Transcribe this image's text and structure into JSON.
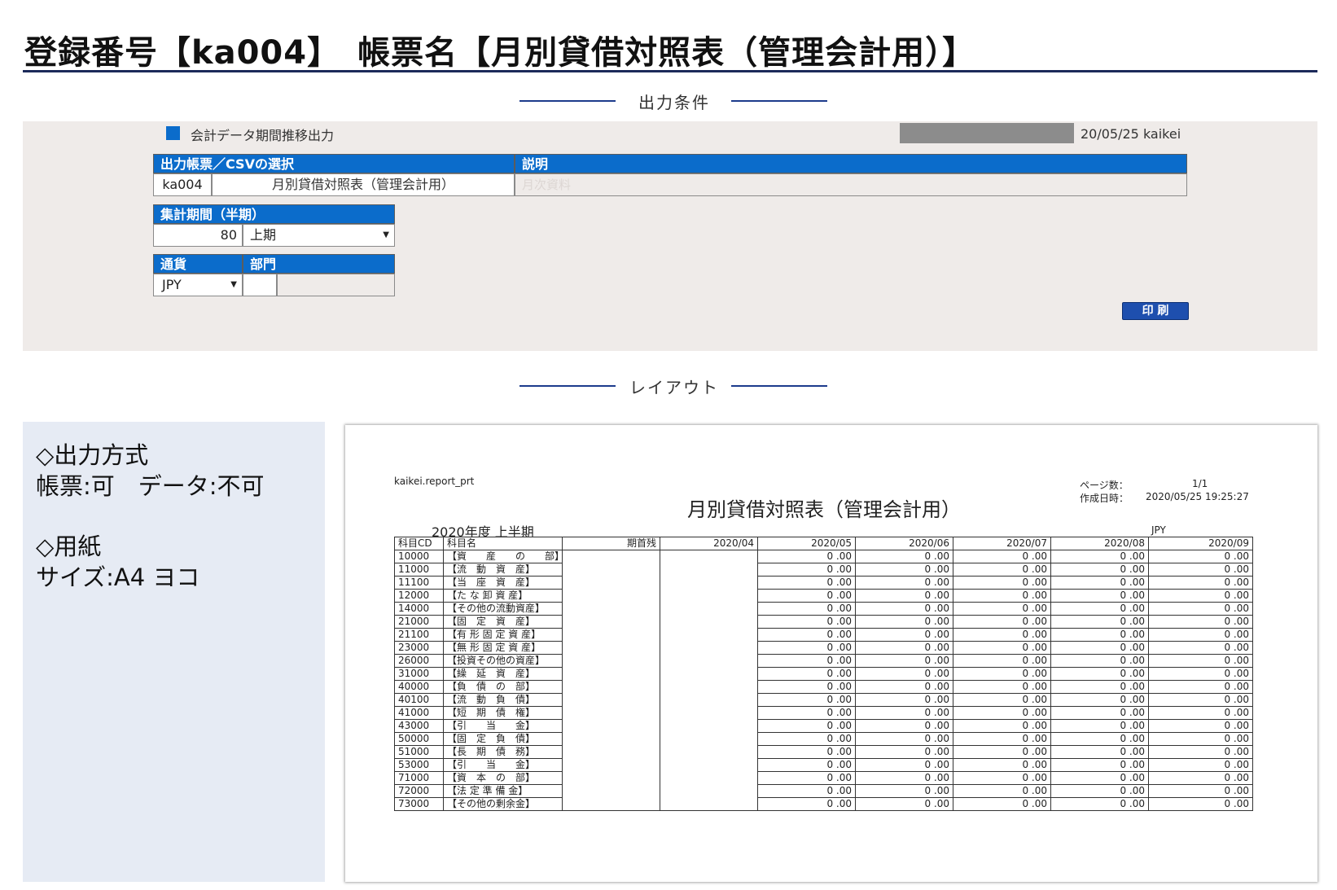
{
  "page_title": "登録番号【ka004】　帳票名【月別貸借対照表（管理会計用）】",
  "sections": {
    "conditions": "出力条件",
    "layout": "レイアウト"
  },
  "conditions": {
    "menu_label": "会計データ期間推移出力",
    "header_date_user": "20/05/25 kaikei",
    "colors": {
      "header_blue": "#0b6ccb",
      "button_blue": "#1e4fae",
      "panel_bg": "#efebe9"
    },
    "report_select": {
      "header_left": "出力帳票／CSVの選択",
      "header_right": "説明",
      "code": "ka004",
      "name": "月別貸借対照表（管理会計用）",
      "description": "月次資料"
    },
    "period": {
      "header": "集計期間（半期）",
      "value": "80",
      "selected": "上期"
    },
    "currency": {
      "header": "通貨",
      "selected": "JPY"
    },
    "department": {
      "header": "部門",
      "value": ""
    },
    "print_button": "印 刷"
  },
  "info": {
    "output_method_title": "◇出力方式",
    "output_method_value": "帳票:可　データ:不可",
    "paper_title": "◇用紙",
    "paper_value": "サイズ:A4 ヨコ"
  },
  "report": {
    "program": "kaikei.report_prt",
    "page_label": "ページ数：",
    "page_value": "1/1",
    "created_label": "作成日時：",
    "created_value": "2020/05/25 19:25:27",
    "title": "月別貸借対照表（管理会計用）",
    "period_label": "2020年度 上半期",
    "currency": "JPY",
    "columns": [
      "科目CD",
      "科目名",
      "期首残",
      "2020/04",
      "2020/05",
      "2020/06",
      "2020/07",
      "2020/08",
      "2020/09"
    ],
    "rows": [
      {
        "cd": "10000",
        "name": "【資　　産　　の　　部】",
        "values": [
          "",
          "",
          "0 .00",
          "0 .00",
          "0 .00",
          "0 .00",
          "0 .00"
        ]
      },
      {
        "cd": "11000",
        "name": "【流　動　資　産】",
        "values": [
          "",
          "",
          "0 .00",
          "0 .00",
          "0 .00",
          "0 .00",
          "0 .00"
        ]
      },
      {
        "cd": "11100",
        "name": "【当　座　資　産】",
        "values": [
          "",
          "",
          "0 .00",
          "0 .00",
          "0 .00",
          "0 .00",
          "0 .00"
        ]
      },
      {
        "cd": "12000",
        "name": "【た な 卸 資 産】",
        "values": [
          "",
          "",
          "0 .00",
          "0 .00",
          "0 .00",
          "0 .00",
          "0 .00"
        ]
      },
      {
        "cd": "14000",
        "name": "【その他の流動資産】",
        "values": [
          "",
          "",
          "0 .00",
          "0 .00",
          "0 .00",
          "0 .00",
          "0 .00"
        ]
      },
      {
        "cd": "21000",
        "name": "【固　定　資　産】",
        "values": [
          "",
          "",
          "0 .00",
          "0 .00",
          "0 .00",
          "0 .00",
          "0 .00"
        ]
      },
      {
        "cd": "21100",
        "name": "【有 形 固 定 資 産】",
        "values": [
          "",
          "",
          "0 .00",
          "0 .00",
          "0 .00",
          "0 .00",
          "0 .00"
        ]
      },
      {
        "cd": "23000",
        "name": "【無 形 固 定 資 産】",
        "values": [
          "",
          "",
          "0 .00",
          "0 .00",
          "0 .00",
          "0 .00",
          "0 .00"
        ]
      },
      {
        "cd": "26000",
        "name": "【投資その他の資産】",
        "values": [
          "",
          "",
          "0 .00",
          "0 .00",
          "0 .00",
          "0 .00",
          "0 .00"
        ]
      },
      {
        "cd": "31000",
        "name": "【繰　延　資　産】",
        "values": [
          "",
          "",
          "0 .00",
          "0 .00",
          "0 .00",
          "0 .00",
          "0 .00"
        ]
      },
      {
        "cd": "40000",
        "name": "【負　債　の　部】",
        "values": [
          "",
          "",
          "0 .00",
          "0 .00",
          "0 .00",
          "0 .00",
          "0 .00"
        ]
      },
      {
        "cd": "40100",
        "name": "【流　動　負　債】",
        "values": [
          "",
          "",
          "0 .00",
          "0 .00",
          "0 .00",
          "0 .00",
          "0 .00"
        ]
      },
      {
        "cd": "41000",
        "name": "【短　期　債　権】",
        "values": [
          "",
          "",
          "0 .00",
          "0 .00",
          "0 .00",
          "0 .00",
          "0 .00"
        ]
      },
      {
        "cd": "43000",
        "name": "【引　　当　　金】",
        "values": [
          "",
          "",
          "0 .00",
          "0 .00",
          "0 .00",
          "0 .00",
          "0 .00"
        ]
      },
      {
        "cd": "50000",
        "name": "【固　定　負　債】",
        "values": [
          "",
          "",
          "0 .00",
          "0 .00",
          "0 .00",
          "0 .00",
          "0 .00"
        ]
      },
      {
        "cd": "51000",
        "name": "【長　期　債　務】",
        "values": [
          "",
          "",
          "0 .00",
          "0 .00",
          "0 .00",
          "0 .00",
          "0 .00"
        ]
      },
      {
        "cd": "53000",
        "name": "【引　　当　　金】",
        "values": [
          "",
          "",
          "0 .00",
          "0 .00",
          "0 .00",
          "0 .00",
          "0 .00"
        ]
      },
      {
        "cd": "71000",
        "name": "【資　本　の　部】",
        "values": [
          "",
          "",
          "0 .00",
          "0 .00",
          "0 .00",
          "0 .00",
          "0 .00"
        ]
      },
      {
        "cd": "72000",
        "name": "【法 定 準 備 金】",
        "values": [
          "",
          "",
          "0 .00",
          "0 .00",
          "0 .00",
          "0 .00",
          "0 .00"
        ]
      },
      {
        "cd": "73000",
        "name": "【その他の剰余金】",
        "values": [
          "",
          "",
          "0 .00",
          "0 .00",
          "0 .00",
          "0 .00",
          "0 .00"
        ]
      }
    ]
  }
}
